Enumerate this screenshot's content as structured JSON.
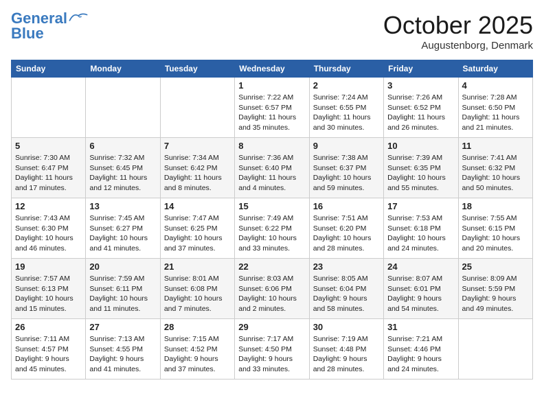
{
  "logo": {
    "line1": "General",
    "line2": "Blue"
  },
  "title": "October 2025",
  "subtitle": "Augustenborg, Denmark",
  "days_header": [
    "Sunday",
    "Monday",
    "Tuesday",
    "Wednesday",
    "Thursday",
    "Friday",
    "Saturday"
  ],
  "weeks": [
    [
      {
        "day": "",
        "info": ""
      },
      {
        "day": "",
        "info": ""
      },
      {
        "day": "",
        "info": ""
      },
      {
        "day": "1",
        "info": "Sunrise: 7:22 AM\nSunset: 6:57 PM\nDaylight: 11 hours\nand 35 minutes."
      },
      {
        "day": "2",
        "info": "Sunrise: 7:24 AM\nSunset: 6:55 PM\nDaylight: 11 hours\nand 30 minutes."
      },
      {
        "day": "3",
        "info": "Sunrise: 7:26 AM\nSunset: 6:52 PM\nDaylight: 11 hours\nand 26 minutes."
      },
      {
        "day": "4",
        "info": "Sunrise: 7:28 AM\nSunset: 6:50 PM\nDaylight: 11 hours\nand 21 minutes."
      }
    ],
    [
      {
        "day": "5",
        "info": "Sunrise: 7:30 AM\nSunset: 6:47 PM\nDaylight: 11 hours\nand 17 minutes."
      },
      {
        "day": "6",
        "info": "Sunrise: 7:32 AM\nSunset: 6:45 PM\nDaylight: 11 hours\nand 12 minutes."
      },
      {
        "day": "7",
        "info": "Sunrise: 7:34 AM\nSunset: 6:42 PM\nDaylight: 11 hours\nand 8 minutes."
      },
      {
        "day": "8",
        "info": "Sunrise: 7:36 AM\nSunset: 6:40 PM\nDaylight: 11 hours\nand 4 minutes."
      },
      {
        "day": "9",
        "info": "Sunrise: 7:38 AM\nSunset: 6:37 PM\nDaylight: 10 hours\nand 59 minutes."
      },
      {
        "day": "10",
        "info": "Sunrise: 7:39 AM\nSunset: 6:35 PM\nDaylight: 10 hours\nand 55 minutes."
      },
      {
        "day": "11",
        "info": "Sunrise: 7:41 AM\nSunset: 6:32 PM\nDaylight: 10 hours\nand 50 minutes."
      }
    ],
    [
      {
        "day": "12",
        "info": "Sunrise: 7:43 AM\nSunset: 6:30 PM\nDaylight: 10 hours\nand 46 minutes."
      },
      {
        "day": "13",
        "info": "Sunrise: 7:45 AM\nSunset: 6:27 PM\nDaylight: 10 hours\nand 41 minutes."
      },
      {
        "day": "14",
        "info": "Sunrise: 7:47 AM\nSunset: 6:25 PM\nDaylight: 10 hours\nand 37 minutes."
      },
      {
        "day": "15",
        "info": "Sunrise: 7:49 AM\nSunset: 6:22 PM\nDaylight: 10 hours\nand 33 minutes."
      },
      {
        "day": "16",
        "info": "Sunrise: 7:51 AM\nSunset: 6:20 PM\nDaylight: 10 hours\nand 28 minutes."
      },
      {
        "day": "17",
        "info": "Sunrise: 7:53 AM\nSunset: 6:18 PM\nDaylight: 10 hours\nand 24 minutes."
      },
      {
        "day": "18",
        "info": "Sunrise: 7:55 AM\nSunset: 6:15 PM\nDaylight: 10 hours\nand 20 minutes."
      }
    ],
    [
      {
        "day": "19",
        "info": "Sunrise: 7:57 AM\nSunset: 6:13 PM\nDaylight: 10 hours\nand 15 minutes."
      },
      {
        "day": "20",
        "info": "Sunrise: 7:59 AM\nSunset: 6:11 PM\nDaylight: 10 hours\nand 11 minutes."
      },
      {
        "day": "21",
        "info": "Sunrise: 8:01 AM\nSunset: 6:08 PM\nDaylight: 10 hours\nand 7 minutes."
      },
      {
        "day": "22",
        "info": "Sunrise: 8:03 AM\nSunset: 6:06 PM\nDaylight: 10 hours\nand 2 minutes."
      },
      {
        "day": "23",
        "info": "Sunrise: 8:05 AM\nSunset: 6:04 PM\nDaylight: 9 hours\nand 58 minutes."
      },
      {
        "day": "24",
        "info": "Sunrise: 8:07 AM\nSunset: 6:01 PM\nDaylight: 9 hours\nand 54 minutes."
      },
      {
        "day": "25",
        "info": "Sunrise: 8:09 AM\nSunset: 5:59 PM\nDaylight: 9 hours\nand 49 minutes."
      }
    ],
    [
      {
        "day": "26",
        "info": "Sunrise: 7:11 AM\nSunset: 4:57 PM\nDaylight: 9 hours\nand 45 minutes."
      },
      {
        "day": "27",
        "info": "Sunrise: 7:13 AM\nSunset: 4:55 PM\nDaylight: 9 hours\nand 41 minutes."
      },
      {
        "day": "28",
        "info": "Sunrise: 7:15 AM\nSunset: 4:52 PM\nDaylight: 9 hours\nand 37 minutes."
      },
      {
        "day": "29",
        "info": "Sunrise: 7:17 AM\nSunset: 4:50 PM\nDaylight: 9 hours\nand 33 minutes."
      },
      {
        "day": "30",
        "info": "Sunrise: 7:19 AM\nSunset: 4:48 PM\nDaylight: 9 hours\nand 28 minutes."
      },
      {
        "day": "31",
        "info": "Sunrise: 7:21 AM\nSunset: 4:46 PM\nDaylight: 9 hours\nand 24 minutes."
      },
      {
        "day": "",
        "info": ""
      }
    ]
  ]
}
